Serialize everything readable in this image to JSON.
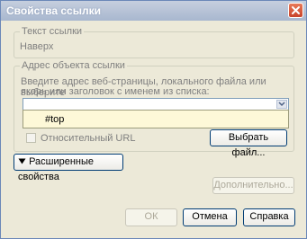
{
  "window": {
    "title": "Свойства ссылки"
  },
  "link_text_group": {
    "label": "Текст ссылки",
    "value": "Наверх"
  },
  "address_group": {
    "label": "Адрес объекта ссылки",
    "instruction_line1": "Введите адрес веб-страницы, локального файла или выберите",
    "instruction_line2": "якорь или заголовок с именем из списка:",
    "url_value": "",
    "dropdown_items": [
      "#top"
    ],
    "relative_url_label": "Относительный URL",
    "relative_url_checked": false,
    "choose_file_label": "Выбрать файл..."
  },
  "advanced_toggle_label": "Расширенные свойства",
  "advanced_edit_label": "Дополнительно...",
  "footer": {
    "ok_label": "ОК",
    "cancel_label": "Отмена",
    "help_label": "Справка"
  }
}
